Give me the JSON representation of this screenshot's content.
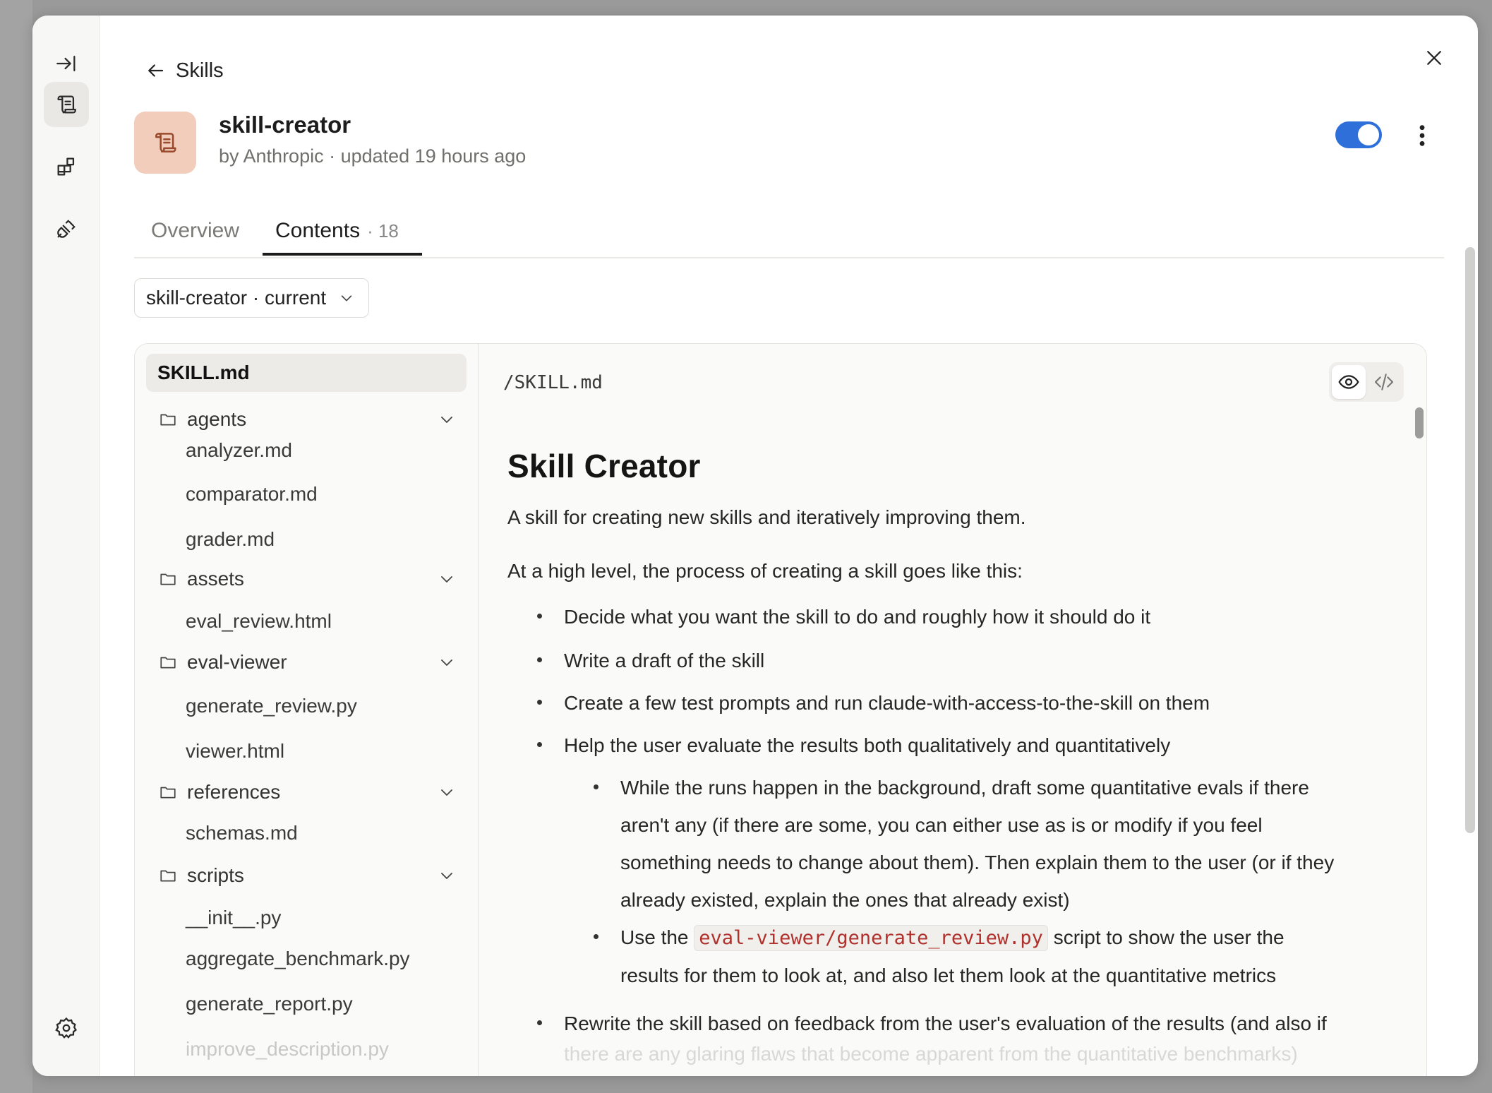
{
  "header": {
    "back_label": "Skills",
    "skill_name": "skill-creator",
    "skill_meta": "by Anthropic · updated 19 hours ago",
    "enabled": true
  },
  "tabs": [
    {
      "label": "Overview",
      "active": false
    },
    {
      "label": "Contents",
      "count": "· 18",
      "active": true
    }
  ],
  "version_select": {
    "value": "skill-creator · current"
  },
  "tree": {
    "selected": "SKILL.md",
    "items": [
      {
        "type": "file-root",
        "label": "SKILL.md"
      },
      {
        "type": "folder",
        "label": "agents"
      },
      {
        "type": "file",
        "label": "analyzer.md"
      },
      {
        "type": "file",
        "label": "comparator.md"
      },
      {
        "type": "file",
        "label": "grader.md"
      },
      {
        "type": "folder",
        "label": "assets"
      },
      {
        "type": "file",
        "label": "eval_review.html"
      },
      {
        "type": "folder",
        "label": "eval-viewer"
      },
      {
        "type": "file",
        "label": "generate_review.py"
      },
      {
        "type": "file",
        "label": "viewer.html"
      },
      {
        "type": "folder",
        "label": "references"
      },
      {
        "type": "file",
        "label": "schemas.md"
      },
      {
        "type": "folder",
        "label": "scripts"
      },
      {
        "type": "file",
        "label": "__init__.py"
      },
      {
        "type": "file",
        "label": "aggregate_benchmark.py"
      },
      {
        "type": "file",
        "label": "generate_report.py"
      },
      {
        "type": "file",
        "label": "improve_description.py"
      }
    ]
  },
  "viewer": {
    "path": "/SKILL.md",
    "title": "Skill Creator",
    "intro": "A skill for creating new skills and iteratively improving them.",
    "lead": "At a high level, the process of creating a skill goes like this:",
    "bullets": [
      "Decide what you want the skill to do and roughly how it should do it",
      "Write a draft of the skill",
      "Create a few test prompts and run claude-with-access-to-the-skill on them",
      "Help the user evaluate the results both qualitatively and quantitatively"
    ],
    "sub_bullets": [
      [
        "While the runs happen in the background, draft some quantitative evals if there",
        "aren't any (if there are some, you can either use as is or modify if you feel",
        "something needs to change about them). Then explain them to the user (or if they",
        "already existed, explain the ones that already exist)"
      ],
      {
        "prefix": "Use the",
        "code": "eval-viewer/generate_review.py",
        "suffix": "script to show the user the",
        "line2": "results for them to look at, and also let them look at the quantitative metrics"
      }
    ],
    "last_bullet": "Rewrite the skill based on feedback from the user's evaluation of the results (and also if",
    "last_bullet_faded": "there are any glaring flaws that become apparent from the quantitative benchmarks)"
  },
  "colors": {
    "accent": "#2f6fd9",
    "skill_icon_bg": "#f2cdbb",
    "code": "#b0312c"
  }
}
